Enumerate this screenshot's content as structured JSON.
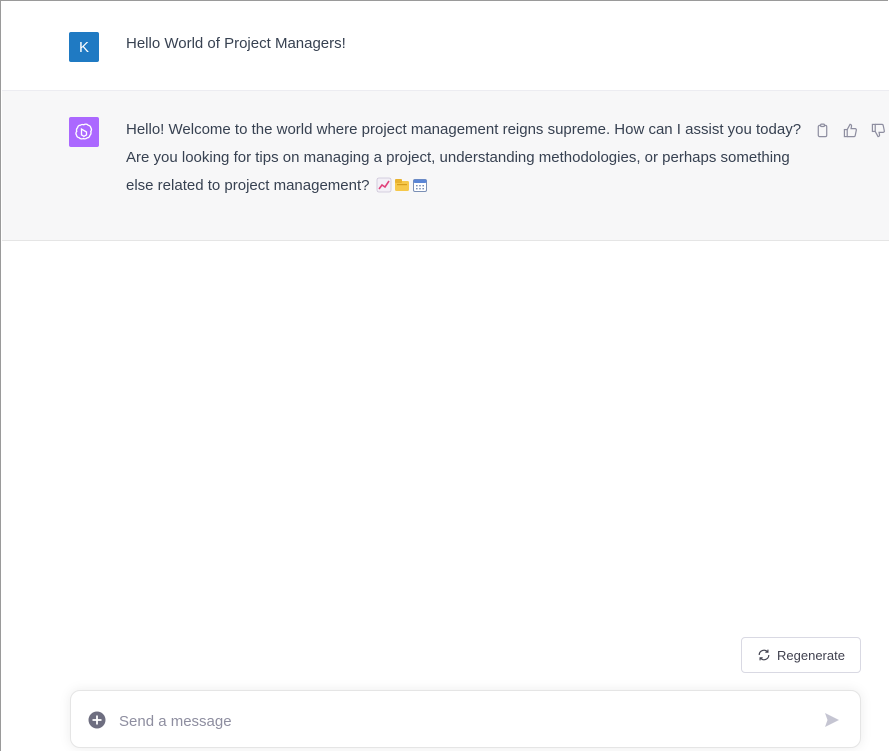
{
  "conversation": {
    "user_message": {
      "avatar_letter": "K",
      "avatar_color": "#1f7ac3",
      "text": "Hello World of Project Managers!"
    },
    "assistant_message": {
      "avatar_color": "#ab68ff",
      "avatar_icon": "openai-logo-icon",
      "text": "Hello! Welcome to the world where project management reigns supreme. How can I assist you today? Are you looking for tips on managing a project, understanding methodologies, or perhaps something else related to project management?",
      "emojis": [
        "chart-increasing-icon",
        "card-index-dividers-icon",
        "calendar-icon"
      ],
      "actions": [
        "copy-icon",
        "thumbs-up-icon",
        "thumbs-down-icon"
      ]
    }
  },
  "regenerate": {
    "label": "Regenerate",
    "icon": "refresh-icon"
  },
  "composer": {
    "placeholder": "Send a message",
    "value": "",
    "attach_icon": "plus-circle-icon",
    "send_icon": "send-icon"
  },
  "colors": {
    "assistant_row_bg": "#f7f7f8",
    "text": "#374151"
  }
}
